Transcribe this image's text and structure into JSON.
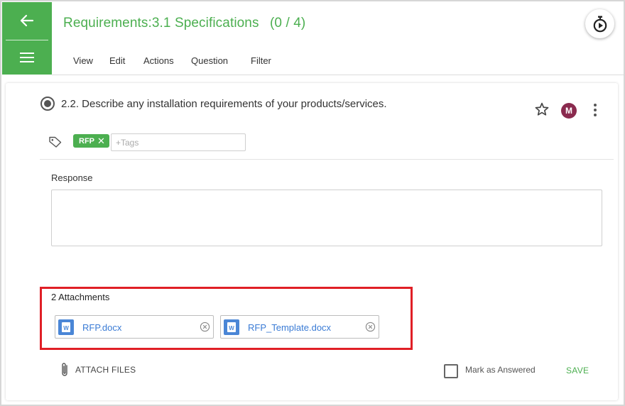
{
  "header": {
    "title": "Requirements:3.1 Specifications",
    "count": "(0 / 4)",
    "menu": [
      "View",
      "Edit",
      "Actions",
      "Question",
      "Filter"
    ]
  },
  "question": {
    "text": "2.2. Describe any installation requirements of your products/services.",
    "avatar_initial": "M",
    "tags": [
      {
        "label": "RFP",
        "remove": "✕"
      }
    ],
    "tag_placeholder": "+Tags"
  },
  "response": {
    "label": "Response",
    "value": ""
  },
  "attachments": {
    "label": "2 Attachments",
    "files": [
      {
        "name": "RFP.docx",
        "icon": "word-doc-icon"
      },
      {
        "name": "RFP_Template.docx",
        "icon": "word-doc-icon"
      }
    ]
  },
  "footer": {
    "attach_label": "ATTACH FILES",
    "mark_answered_label": "Mark as Answered",
    "save_label": "SAVE"
  },
  "colors": {
    "accent": "#4caf50",
    "highlight": "#e01f26",
    "link": "#3a7bd5",
    "avatar": "#8a2a4e"
  }
}
